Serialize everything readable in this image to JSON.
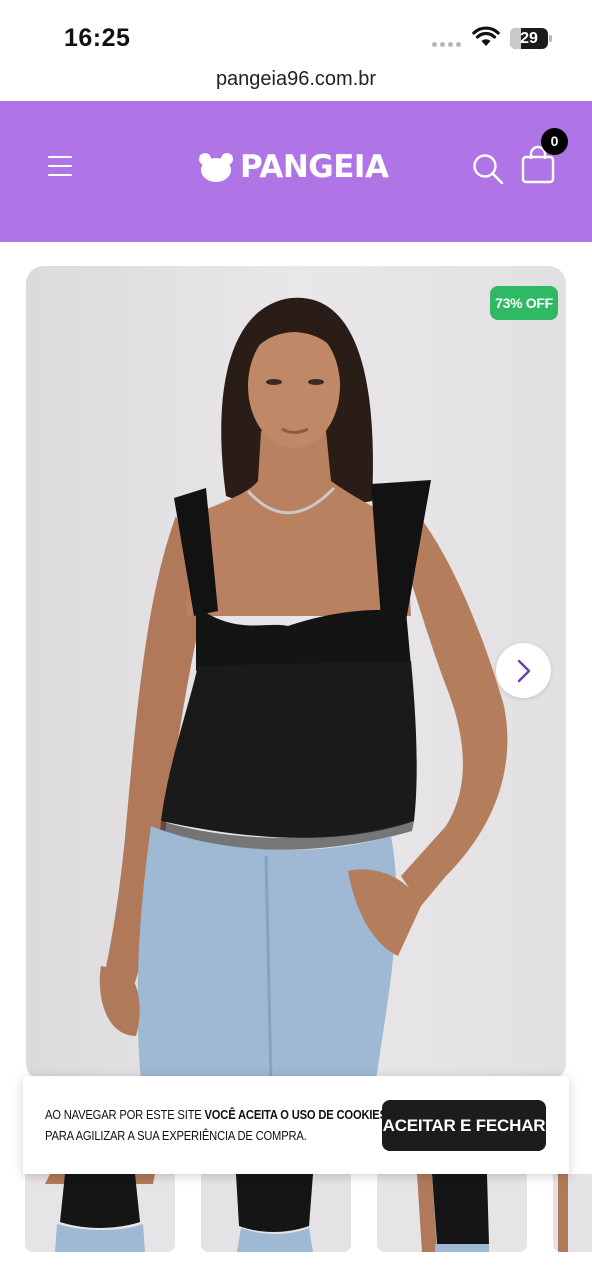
{
  "status_bar": {
    "time": "16:25",
    "battery": "29",
    "battery_level": 0.29
  },
  "browser": {
    "url": "pangeia96.com.br"
  },
  "header": {
    "brand": "PANGEIA",
    "cart_count": "0",
    "background_color": "#af75e6",
    "icons": [
      "hamburger-menu-icon",
      "bear-logo-icon",
      "search-icon",
      "shopping-bag-icon"
    ]
  },
  "product": {
    "discount_badge": "73% OFF",
    "badge_color": "#2fb965",
    "gallery_next_icon": "chevron-right-icon"
  },
  "cookie_banner": {
    "text_part1": "AO NAVEGAR POR ESTE SITE ",
    "text_bold": "VOCÊ ACEITA O USO DE COOKIES",
    "text_part2": "PARA AGILIZAR A SUA EXPERIÊNCIA DE COMPRA.",
    "accept_label": "ACEITAR E FECHAR"
  }
}
